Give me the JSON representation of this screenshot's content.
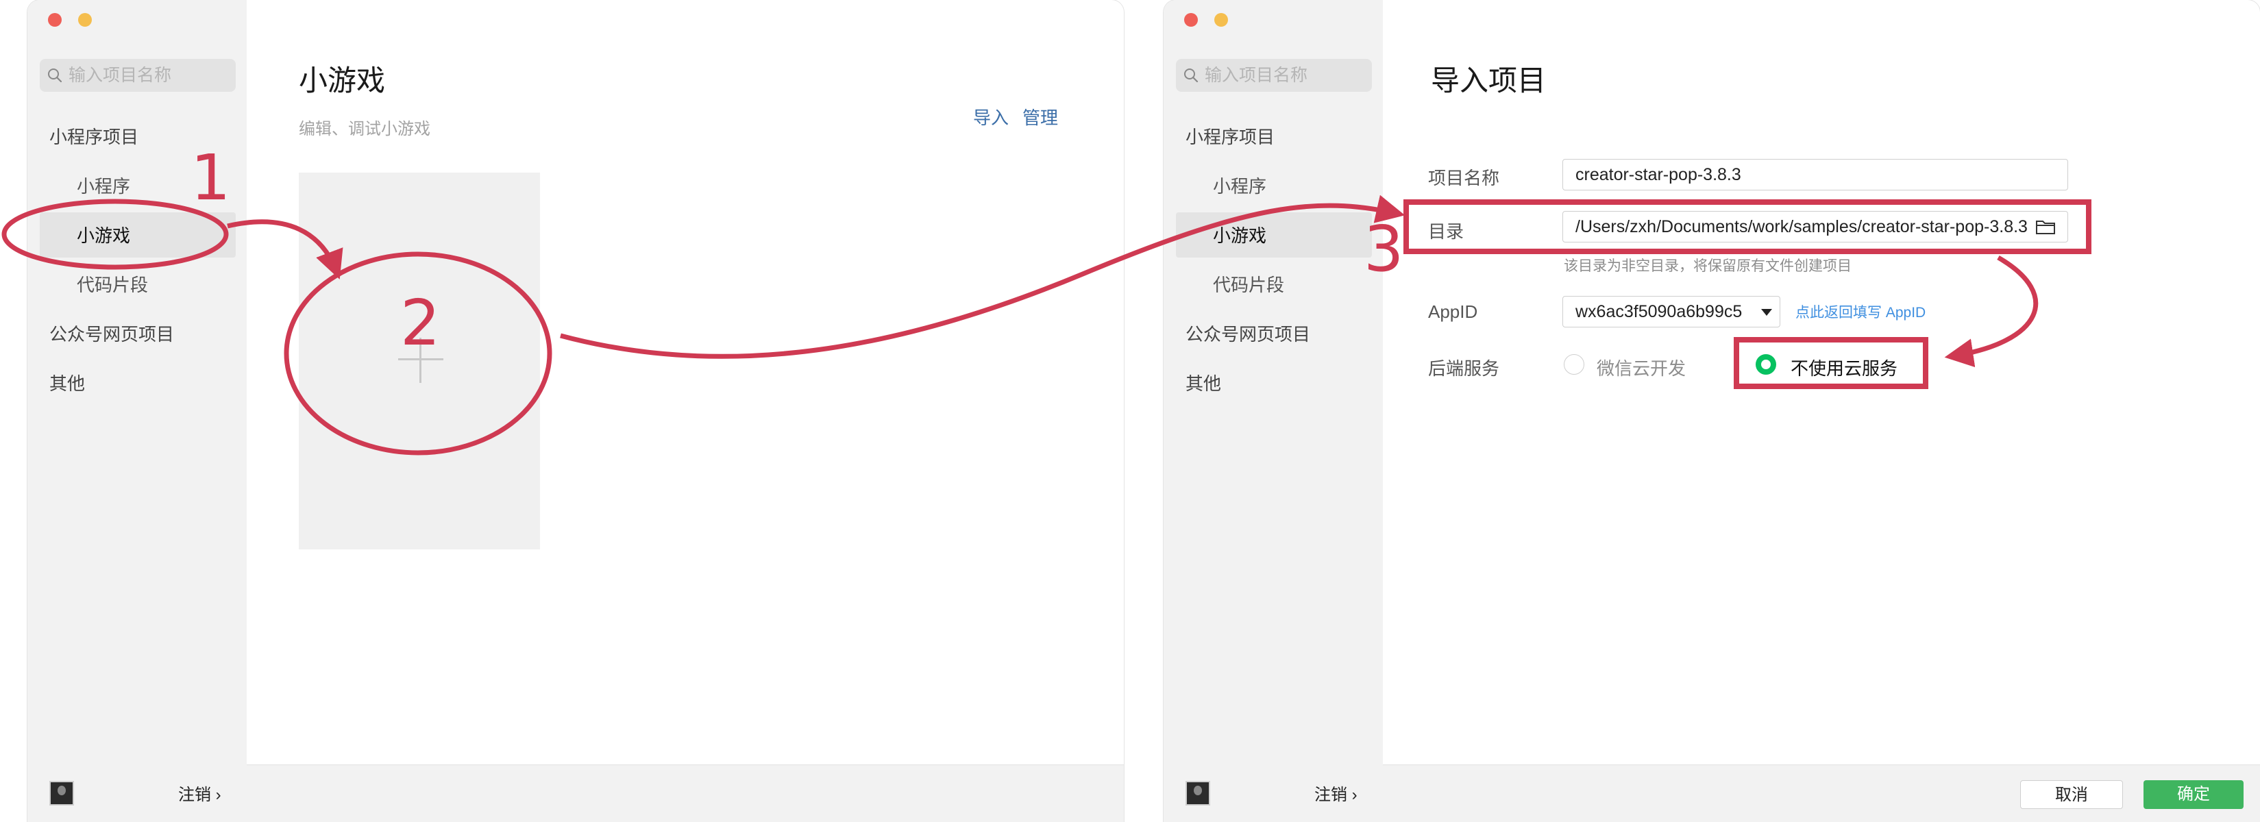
{
  "left_window": {
    "search_placeholder": "输入项目名称",
    "sidebar": {
      "category_miniprogram": "小程序项目",
      "item_miniprogram": "小程序",
      "item_minigame": "小游戏",
      "item_snippet": "代码片段",
      "category_official_web": "公众号网页项目",
      "category_other": "其他"
    },
    "logout": "注销",
    "logout_chevron": "›",
    "title": "小游戏",
    "subtitle": "编辑、调试小游戏",
    "import_link": "导入",
    "manage_link": "管理",
    "add_project_glyph": "+"
  },
  "right_window": {
    "search_placeholder": "输入项目名称",
    "sidebar": {
      "category_miniprogram": "小程序项目",
      "item_miniprogram": "小程序",
      "item_minigame": "小游戏",
      "item_snippet": "代码片段",
      "category_official_web": "公众号网页项目",
      "category_other": "其他"
    },
    "logout": "注销",
    "logout_chevron": "›",
    "title": "导入项目",
    "form": {
      "project_name_label": "项目名称",
      "project_name_value": "creator-star-pop-3.8.3",
      "directory_label": "目录",
      "directory_value": "/Users/zxh/Documents/work/samples/creator-star-pop-3.8.3",
      "directory_hint": "该目录为非空目录，将保留原有文件创建项目",
      "appid_label": "AppID",
      "appid_value": "wx6ac3f5090a6b99c5",
      "appid_link_text": "点此返回填写",
      "appid_link_suffix": "AppID",
      "backend_label": "后端服务",
      "backend_option_cloud": "微信云开发",
      "backend_option_none": "不使用云服务",
      "backend_selected": "不使用云服务"
    },
    "cancel_button": "取消",
    "confirm_button": "确定"
  },
  "annotations": {
    "step1": "1",
    "step2": "2",
    "step3": "3",
    "color": "#cf3a52"
  }
}
